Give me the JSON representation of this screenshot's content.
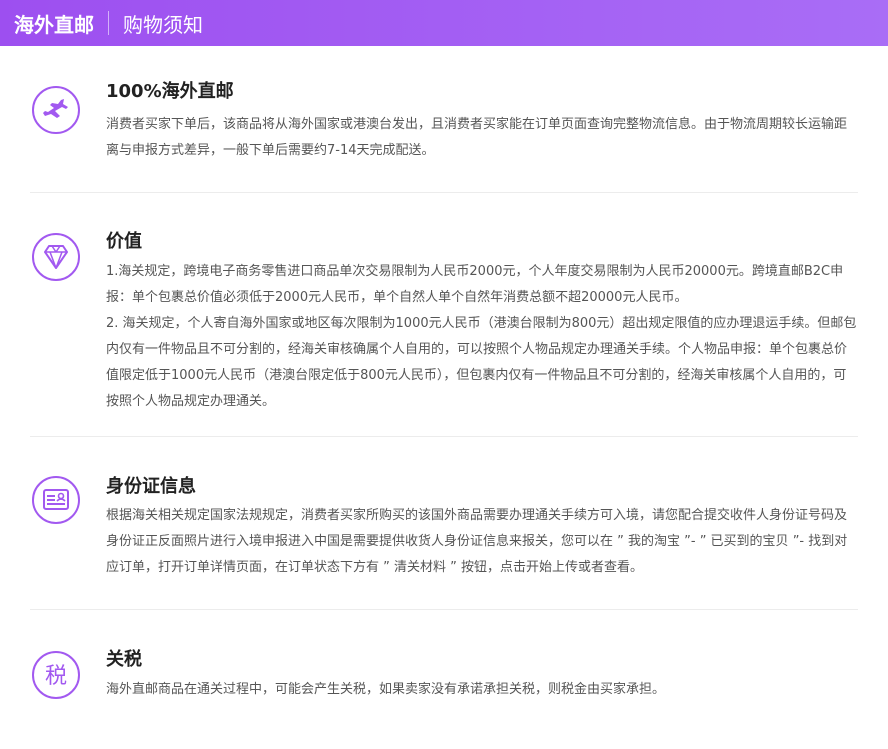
{
  "header": {
    "title": "海外直邮",
    "subtitle": "购物须知"
  },
  "sections": [
    {
      "icon": "airplane-icon",
      "title": "100%海外直邮",
      "paragraphs": [
        "消费者买家下单后，该商品将从海外国家或港澳台发出，且消费者买家能在订单页面查询完整物流信息。由于物流周期较长运输距离与申报方式差异，一般下单后需要约7-14天完成配送。"
      ]
    },
    {
      "icon": "diamond-icon",
      "title": "价值",
      "paragraphs": [
        "1.海关规定，跨境电子商务零售进口商品单次交易限制为人民币2000元，个人年度交易限制为人民币20000元。跨境直邮B2C申报：单个包裹总价值必须低于2000元人民币，单个自然人单个自然年消费总额不超20000元人民币。",
        "2. 海关规定，个人寄自海外国家或地区每次限制为1000元人民币（港澳台限制为800元）超出规定限值的应办理退运手续。但邮包内仅有一件物品且不可分割的，经海关审核确属个人自用的，可以按照个人物品规定办理通关手续。个人物品申报：单个包裹总价值限定低于1000元人民币（港澳台限定低于800元人民币），但包裹内仅有一件物品且不可分割的，经海关审核属个人自用的，可按照个人物品规定办理通关。"
      ]
    },
    {
      "icon": "id-card-icon",
      "title": "身份证信息",
      "paragraphs": [
        "根据海关相关规定国家法规规定，消费者买家所购买的该国外商品需要办理通关手续方可入境，请您配合提交收件人身份证号码及身份证正反面照片进行入境申报进入中国是需要提供收货人身份证信息来报关，您可以在 ” 我的淘宝 ”- ” 已买到的宝贝 ”- 找到对应订单，打开订单详情页面，在订单状态下方有 ” 清关材料 ” 按钮，点击开始上传或者查看。"
      ]
    },
    {
      "icon": "tax-icon",
      "icon_char": "税",
      "title": "关税",
      "paragraphs": [
        "海外直邮商品在通关过程中，可能会产生关税，如果卖家没有承诺承担关税，则税金由买家承担。"
      ]
    }
  ],
  "colors": {
    "accent": "#9d4ff0",
    "icon_stroke": "#a259f0",
    "text": "#555555",
    "title": "#222222"
  }
}
